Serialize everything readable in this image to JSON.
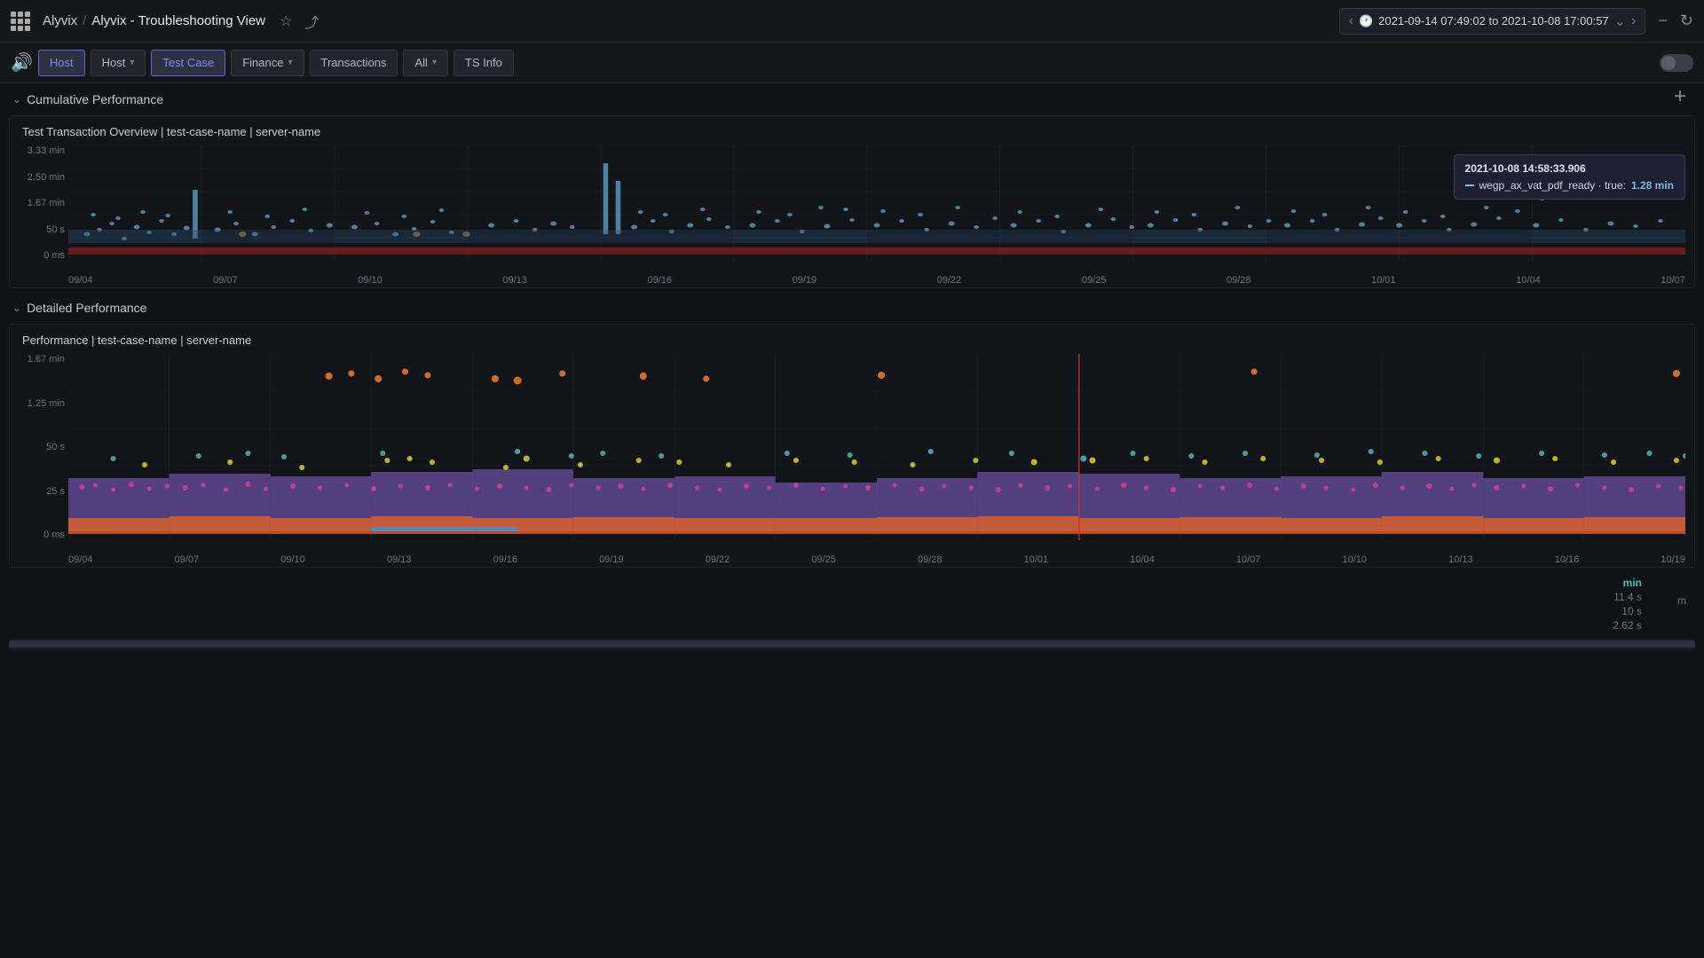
{
  "app": {
    "grid_icon": "grid-icon",
    "breadcrumb_root": "Alyvix",
    "breadcrumb_sep": "/",
    "breadcrumb_current": "Alyvix - Troubleshooting View",
    "star_icon": "star",
    "share_icon": "share",
    "volume_icon": "🔊",
    "time_range": "2021-09-14 07:49:02 to 2021-10-08 17:00:57",
    "zoom_minus": "−",
    "refresh": "↻",
    "add_panel": "+"
  },
  "toolbar": {
    "host_label": "Host",
    "host_dropdown": "Host",
    "test_case_label": "Test Case",
    "finance_label": "Finance",
    "transactions_label": "Transactions",
    "all_label": "All",
    "ts_info_label": "TS Info"
  },
  "cumulative": {
    "section_title": "Cumulative Performance",
    "chart_title": "Test Transaction Overview | test-case-name | server-name",
    "y_labels": [
      "3.33 min",
      "2.50 min",
      "1.67 min",
      "50 s",
      "0 ms"
    ],
    "x_labels": [
      "09/04",
      "09/07",
      "09/10",
      "09/13",
      "09/16",
      "09/19",
      "09/22",
      "09/25",
      "09/28",
      "10/01",
      "10/04",
      "10/07"
    ],
    "tooltip": {
      "time": "2021-10-08 14:58:33.906",
      "entry": "wegp_ax_vat_pdf_ready · true:",
      "value": "1.28 min"
    }
  },
  "detailed": {
    "section_title": "Detailed Performance",
    "chart_title": "Performance | test-case-name | server-name",
    "y_labels": [
      "1.67 min",
      "1.25 min",
      "50 s",
      "25 s",
      "0 ms"
    ],
    "x_labels": [
      "09/04",
      "09/07",
      "09/10",
      "09/13",
      "09/16",
      "09/19",
      "09/22",
      "09/25",
      "09/28",
      "10/01",
      "10/04",
      "10/07",
      "10/10",
      "10/13",
      "10/16",
      "10/19"
    ]
  },
  "bottom_legend": {
    "label_min": "min",
    "label_m": "m",
    "values": [
      "11.4 s",
      "10 s",
      "2.62 s"
    ]
  },
  "colors": {
    "accent_blue": "#5b9bd5",
    "cyan": "#4dbbbb",
    "orange": "#e8943a",
    "yellow": "#d4bc3c",
    "purple": "#7b5ea7",
    "pink": "#d44f8a",
    "red": "#c0392b",
    "green": "#3dbe6c"
  }
}
